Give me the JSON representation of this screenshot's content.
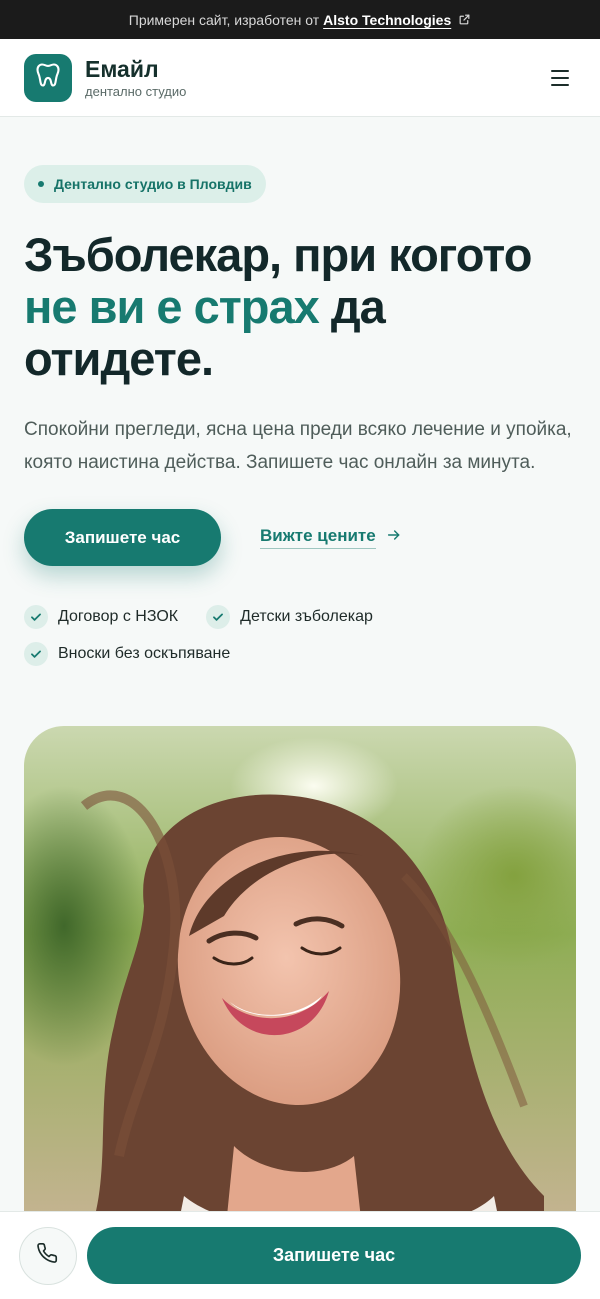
{
  "topbar": {
    "text": "Примерен сайт, изработен от",
    "brand": "Alsto Technologies",
    "icon": "external-link-icon"
  },
  "header": {
    "name": "Емайл",
    "subtitle": "дентално студио",
    "logo_icon": "tooth-icon",
    "menu_icon": "hamburger-icon"
  },
  "hero": {
    "badge": "Дентално студио в Пловдив",
    "title_line1": "Зъболекар, при когото",
    "title_accent": "не ви е страх",
    "title_rest": " да",
    "title_line3": "отидете.",
    "lead": "Спокойни прегледи, ясна цена преди всяко лечение и упойка, която наистина действа. Запишете час онлайн за минута.",
    "cta_primary": "Запишете час",
    "cta_secondary": "Вижте цените",
    "features": [
      "Договор с НЗОК",
      "Детски зъболекар",
      "Вноски без оскъпяване"
    ]
  },
  "bottom_bar": {
    "phone_icon": "phone-icon",
    "cta": "Запишете час"
  },
  "colors": {
    "accent": "#177a70",
    "heading": "#13282a",
    "badge_bg": "#dcefe9",
    "topbar_bg": "#1b1b1b"
  }
}
